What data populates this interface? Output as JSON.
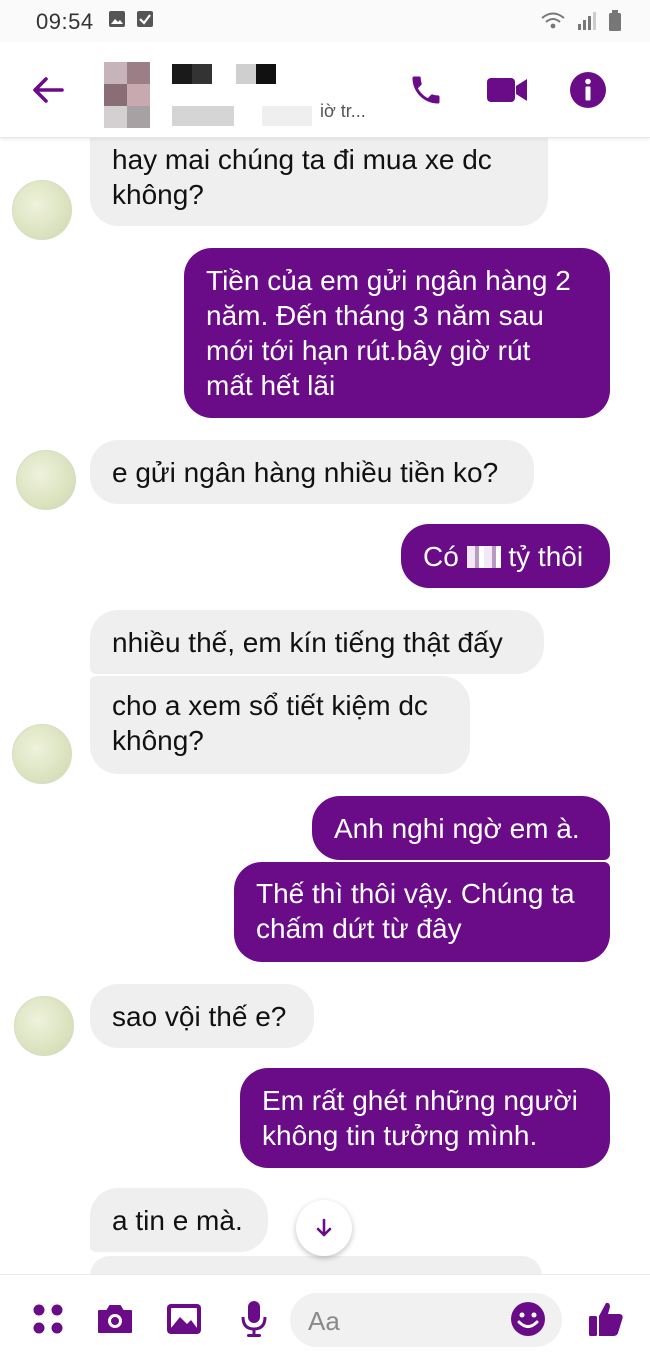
{
  "status_bar": {
    "time": "09:54"
  },
  "header": {
    "subtitle": "iờ tr..."
  },
  "messages": [
    {
      "side": "recv",
      "text": "hay mai chúng ta đi mua xe dc\nkhông?"
    },
    {
      "side": "sent",
      "text": "Tiền của em gửi ngân hàng 2\nnăm. Đến tháng 3 năm sau\nmới tới hạn rút.bây giờ rút\nmất hết lãi"
    },
    {
      "side": "recv",
      "text": "e gửi ngân hàng nhiều tiền ko?"
    },
    {
      "side": "sent",
      "text_before": "Có ",
      "text_after": " tỷ thôi"
    },
    {
      "side": "recv",
      "text": "nhiều thế, em kín tiếng thật đấy"
    },
    {
      "side": "recv",
      "text": "cho a xem sổ tiết kiệm dc\nkhông?"
    },
    {
      "side": "sent",
      "text": "Anh nghi ngờ em à."
    },
    {
      "side": "sent",
      "text": "Thế thì thôi vậy. Chúng ta\nchấm dứt từ đây"
    },
    {
      "side": "recv",
      "text": "sao vội thế e?"
    },
    {
      "side": "sent",
      "text": "Em rất ghét những người\nkhông tin tưởng mình."
    },
    {
      "side": "recv",
      "text": "a tin e mà."
    }
  ],
  "composer": {
    "placeholder": "Aa"
  },
  "colors": {
    "accent": "#6a0b88",
    "received_bubble": "#efefef"
  },
  "icons": [
    "back-arrow-icon",
    "phone-icon",
    "video-camera-icon",
    "info-icon",
    "chevron-down-icon",
    "menu-dots-icon",
    "camera-icon",
    "image-icon",
    "microphone-icon",
    "emoji-icon",
    "thumbs-up-icon"
  ]
}
